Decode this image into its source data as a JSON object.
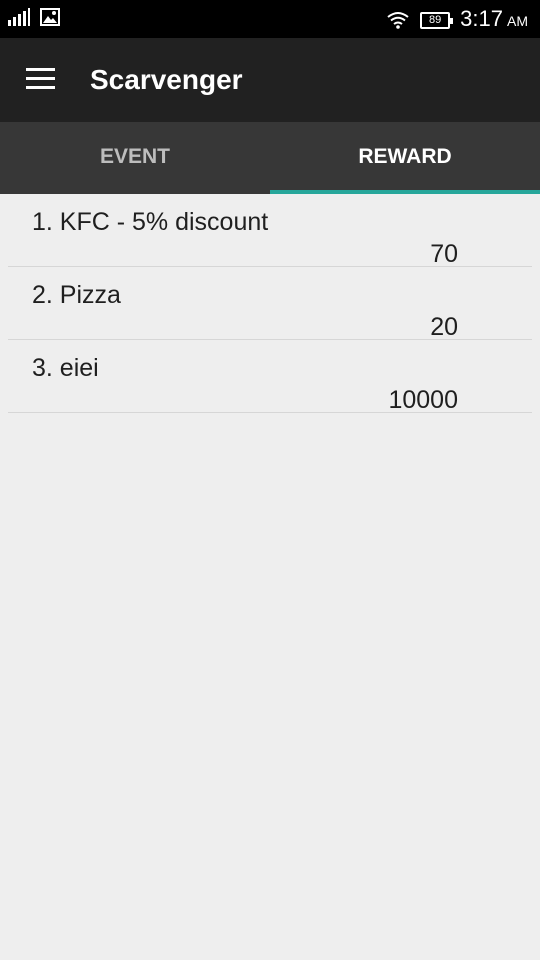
{
  "status_bar": {
    "time": "3:17",
    "ampm": "AM",
    "battery": "89"
  },
  "toolbar": {
    "title": "Scarvenger"
  },
  "tabs": [
    {
      "label": "EVENT",
      "active": false
    },
    {
      "label": "REWARD",
      "active": true
    }
  ],
  "rewards": [
    {
      "title": "1.  KFC - 5% discount",
      "points": "70"
    },
    {
      "title": "2.  Pizza",
      "points": "20"
    },
    {
      "title": "3.  eiei",
      "points": "10000"
    }
  ],
  "colors": {
    "toolbar": "#212121",
    "tabs": "#373737",
    "indicator": "#26a69a",
    "background": "#eeeeee"
  }
}
